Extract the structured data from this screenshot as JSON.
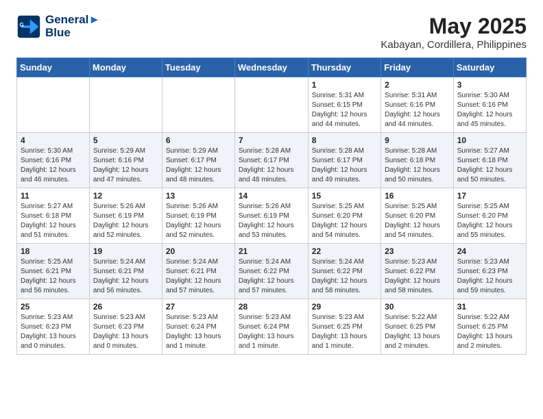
{
  "header": {
    "logo_line1": "General",
    "logo_line2": "Blue",
    "month_year": "May 2025",
    "location": "Kabayan, Cordillera, Philippines"
  },
  "weekdays": [
    "Sunday",
    "Monday",
    "Tuesday",
    "Wednesday",
    "Thursday",
    "Friday",
    "Saturday"
  ],
  "weeks": [
    [
      {
        "day": "",
        "info": ""
      },
      {
        "day": "",
        "info": ""
      },
      {
        "day": "",
        "info": ""
      },
      {
        "day": "",
        "info": ""
      },
      {
        "day": "1",
        "info": "Sunrise: 5:31 AM\nSunset: 6:15 PM\nDaylight: 12 hours\nand 44 minutes."
      },
      {
        "day": "2",
        "info": "Sunrise: 5:31 AM\nSunset: 6:16 PM\nDaylight: 12 hours\nand 44 minutes."
      },
      {
        "day": "3",
        "info": "Sunrise: 5:30 AM\nSunset: 6:16 PM\nDaylight: 12 hours\nand 45 minutes."
      }
    ],
    [
      {
        "day": "4",
        "info": "Sunrise: 5:30 AM\nSunset: 6:16 PM\nDaylight: 12 hours\nand 46 minutes."
      },
      {
        "day": "5",
        "info": "Sunrise: 5:29 AM\nSunset: 6:16 PM\nDaylight: 12 hours\nand 47 minutes."
      },
      {
        "day": "6",
        "info": "Sunrise: 5:29 AM\nSunset: 6:17 PM\nDaylight: 12 hours\nand 48 minutes."
      },
      {
        "day": "7",
        "info": "Sunrise: 5:28 AM\nSunset: 6:17 PM\nDaylight: 12 hours\nand 48 minutes."
      },
      {
        "day": "8",
        "info": "Sunrise: 5:28 AM\nSunset: 6:17 PM\nDaylight: 12 hours\nand 49 minutes."
      },
      {
        "day": "9",
        "info": "Sunrise: 5:28 AM\nSunset: 6:18 PM\nDaylight: 12 hours\nand 50 minutes."
      },
      {
        "day": "10",
        "info": "Sunrise: 5:27 AM\nSunset: 6:18 PM\nDaylight: 12 hours\nand 50 minutes."
      }
    ],
    [
      {
        "day": "11",
        "info": "Sunrise: 5:27 AM\nSunset: 6:18 PM\nDaylight: 12 hours\nand 51 minutes."
      },
      {
        "day": "12",
        "info": "Sunrise: 5:26 AM\nSunset: 6:19 PM\nDaylight: 12 hours\nand 52 minutes."
      },
      {
        "day": "13",
        "info": "Sunrise: 5:26 AM\nSunset: 6:19 PM\nDaylight: 12 hours\nand 52 minutes."
      },
      {
        "day": "14",
        "info": "Sunrise: 5:26 AM\nSunset: 6:19 PM\nDaylight: 12 hours\nand 53 minutes."
      },
      {
        "day": "15",
        "info": "Sunrise: 5:25 AM\nSunset: 6:20 PM\nDaylight: 12 hours\nand 54 minutes."
      },
      {
        "day": "16",
        "info": "Sunrise: 5:25 AM\nSunset: 6:20 PM\nDaylight: 12 hours\nand 54 minutes."
      },
      {
        "day": "17",
        "info": "Sunrise: 5:25 AM\nSunset: 6:20 PM\nDaylight: 12 hours\nand 55 minutes."
      }
    ],
    [
      {
        "day": "18",
        "info": "Sunrise: 5:25 AM\nSunset: 6:21 PM\nDaylight: 12 hours\nand 56 minutes."
      },
      {
        "day": "19",
        "info": "Sunrise: 5:24 AM\nSunset: 6:21 PM\nDaylight: 12 hours\nand 56 minutes."
      },
      {
        "day": "20",
        "info": "Sunrise: 5:24 AM\nSunset: 6:21 PM\nDaylight: 12 hours\nand 57 minutes."
      },
      {
        "day": "21",
        "info": "Sunrise: 5:24 AM\nSunset: 6:22 PM\nDaylight: 12 hours\nand 57 minutes."
      },
      {
        "day": "22",
        "info": "Sunrise: 5:24 AM\nSunset: 6:22 PM\nDaylight: 12 hours\nand 58 minutes."
      },
      {
        "day": "23",
        "info": "Sunrise: 5:23 AM\nSunset: 6:22 PM\nDaylight: 12 hours\nand 58 minutes."
      },
      {
        "day": "24",
        "info": "Sunrise: 5:23 AM\nSunset: 6:23 PM\nDaylight: 12 hours\nand 59 minutes."
      }
    ],
    [
      {
        "day": "25",
        "info": "Sunrise: 5:23 AM\nSunset: 6:23 PM\nDaylight: 13 hours\nand 0 minutes."
      },
      {
        "day": "26",
        "info": "Sunrise: 5:23 AM\nSunset: 6:23 PM\nDaylight: 13 hours\nand 0 minutes."
      },
      {
        "day": "27",
        "info": "Sunrise: 5:23 AM\nSunset: 6:24 PM\nDaylight: 13 hours\nand 1 minute."
      },
      {
        "day": "28",
        "info": "Sunrise: 5:23 AM\nSunset: 6:24 PM\nDaylight: 13 hours\nand 1 minute."
      },
      {
        "day": "29",
        "info": "Sunrise: 5:23 AM\nSunset: 6:25 PM\nDaylight: 13 hours\nand 1 minute."
      },
      {
        "day": "30",
        "info": "Sunrise: 5:22 AM\nSunset: 6:25 PM\nDaylight: 13 hours\nand 2 minutes."
      },
      {
        "day": "31",
        "info": "Sunrise: 5:22 AM\nSunset: 6:25 PM\nDaylight: 13 hours\nand 2 minutes."
      }
    ]
  ]
}
